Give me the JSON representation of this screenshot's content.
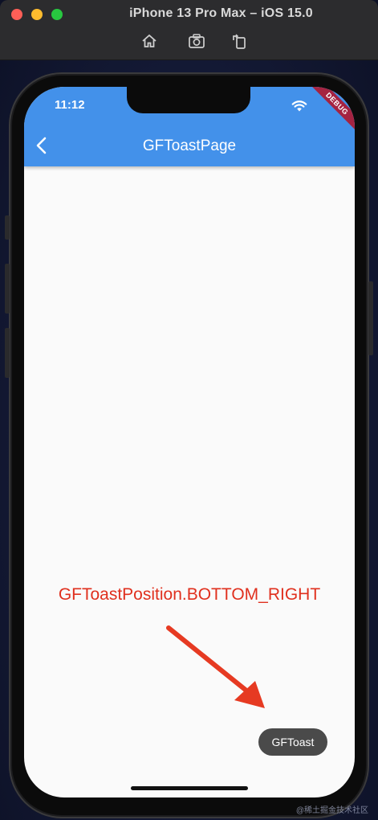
{
  "window": {
    "title": "iPhone 13 Pro Max – iOS 15.0",
    "toolbar": [
      "home-icon",
      "screenshot-icon",
      "rotate-icon"
    ]
  },
  "status_bar": {
    "time": "11:12"
  },
  "app_bar": {
    "title": "GFToastPage",
    "debug_badge": "DEBUG"
  },
  "content": {
    "position_label": "GFToastPosition.BOTTOM_RIGHT",
    "toast_text": "GFToast"
  },
  "watermark": "@稀土掘金技术社区",
  "colors": {
    "app_bar": "#4391ea",
    "label": "#e0301e",
    "toast_bg": "#4a4a4a",
    "debug": "#a52341"
  }
}
